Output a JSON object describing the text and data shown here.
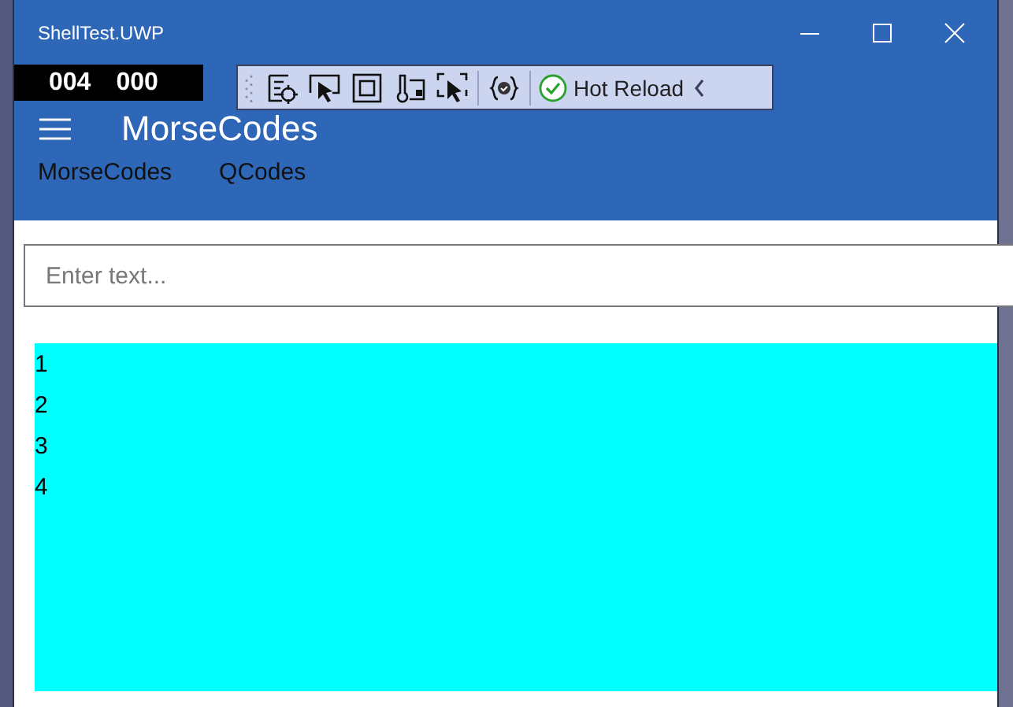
{
  "window": {
    "title": "ShellTest.UWP"
  },
  "frame_counter": [
    "004",
    "000"
  ],
  "debug_toolbar": {
    "hot_reload": "Hot Reload"
  },
  "header": {
    "title": "MorseCodes"
  },
  "tabs": [
    {
      "label": "MorseCodes"
    },
    {
      "label": "QCodes"
    }
  ],
  "search": {
    "placeholder": "Enter text..."
  },
  "list": [
    "1",
    "2",
    "3",
    "4"
  ]
}
